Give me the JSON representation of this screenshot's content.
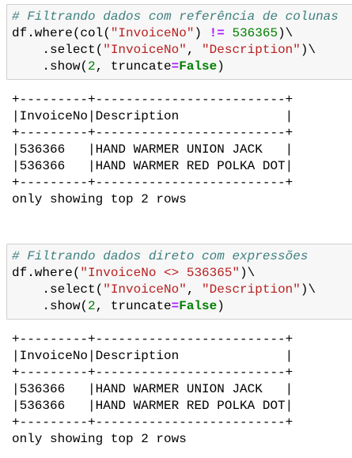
{
  "cells": [
    {
      "code": [
        [
          {
            "t": "# Filtrando dados com referência de colunas",
            "c": "c"
          }
        ],
        [
          {
            "t": "df.where(col(",
            "c": ""
          },
          {
            "t": "\"InvoiceNo\"",
            "c": "s"
          },
          {
            "t": ") ",
            "c": ""
          },
          {
            "t": "!=",
            "c": "o"
          },
          {
            "t": " ",
            "c": ""
          },
          {
            "t": "536365",
            "c": "n"
          },
          {
            "t": ")\\",
            "c": ""
          }
        ],
        [
          {
            "t": "    .select(",
            "c": ""
          },
          {
            "t": "\"InvoiceNo\"",
            "c": "s"
          },
          {
            "t": ", ",
            "c": ""
          },
          {
            "t": "\"Description\"",
            "c": "s"
          },
          {
            "t": ")\\",
            "c": ""
          }
        ],
        [
          {
            "t": "    .show(",
            "c": ""
          },
          {
            "t": "2",
            "c": "n"
          },
          {
            "t": ", truncate",
            "c": ""
          },
          {
            "t": "=",
            "c": "o"
          },
          {
            "t": "False",
            "c": "k"
          },
          {
            "t": ")",
            "c": ""
          }
        ]
      ],
      "output": [
        "+---------+-------------------------+",
        "|InvoiceNo|Description              |",
        "+---------+-------------------------+",
        "|536366   |HAND WARMER UNION JACK   |",
        "|536366   |HAND WARMER RED POLKA DOT|",
        "+---------+-------------------------+",
        "only showing top 2 rows"
      ]
    },
    {
      "code": [
        [
          {
            "t": "# Filtrando dados direto com expressões",
            "c": "c"
          }
        ],
        [
          {
            "t": "df.where(",
            "c": ""
          },
          {
            "t": "\"InvoiceNo <> 536365\"",
            "c": "s"
          },
          {
            "t": ")\\",
            "c": ""
          }
        ],
        [
          {
            "t": "    .select(",
            "c": ""
          },
          {
            "t": "\"InvoiceNo\"",
            "c": "s"
          },
          {
            "t": ", ",
            "c": ""
          },
          {
            "t": "\"Description\"",
            "c": "s"
          },
          {
            "t": ")\\",
            "c": ""
          }
        ],
        [
          {
            "t": "    .show(",
            "c": ""
          },
          {
            "t": "2",
            "c": "n"
          },
          {
            "t": ", truncate",
            "c": ""
          },
          {
            "t": "=",
            "c": "o"
          },
          {
            "t": "False",
            "c": "k"
          },
          {
            "t": ")",
            "c": ""
          }
        ]
      ],
      "output": [
        "+---------+-------------------------+",
        "|InvoiceNo|Description              |",
        "+---------+-------------------------+",
        "|536366   |HAND WARMER UNION JACK   |",
        "|536366   |HAND WARMER RED POLKA DOT|",
        "+---------+-------------------------+",
        "only showing top 2 rows"
      ]
    }
  ]
}
